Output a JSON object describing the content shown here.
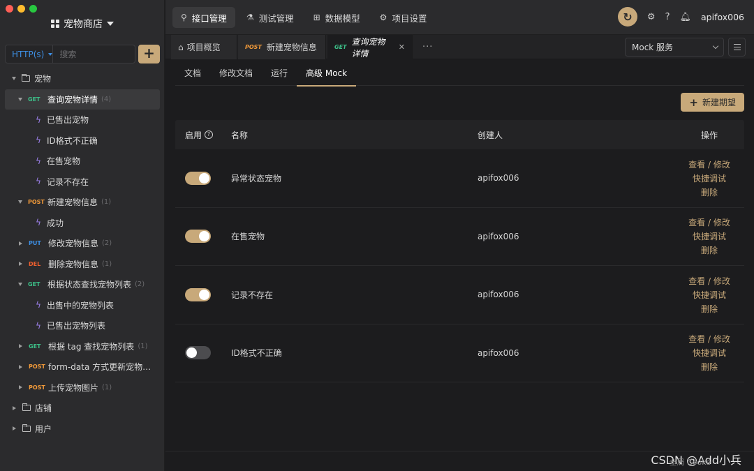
{
  "project": {
    "name": "宠物商店"
  },
  "search": {
    "method": "HTTP(s)",
    "placeholder": "搜索"
  },
  "tree": {
    "root_folder": "宠物",
    "items": [
      {
        "method": "GET",
        "label": "查询宠物详情",
        "count": "(4)"
      },
      {
        "label": "已售出宠物"
      },
      {
        "label": "ID格式不正确"
      },
      {
        "label": "在售宠物"
      },
      {
        "label": "记录不存在"
      },
      {
        "method": "POST",
        "label": "新建宠物信息",
        "count": "(1)"
      },
      {
        "label": "成功"
      },
      {
        "method": "PUT",
        "label": "修改宠物信息",
        "count": "(2)"
      },
      {
        "method": "DEL",
        "label": "删除宠物信息",
        "count": "(1)"
      },
      {
        "method": "GET",
        "label": "根据状态查找宠物列表",
        "count": "(2)"
      },
      {
        "label": "出售中的宠物列表"
      },
      {
        "label": "已售出宠物列表"
      },
      {
        "method": "GET",
        "label": "根据 tag 查找宠物列表",
        "count": "(1)"
      },
      {
        "method": "POST",
        "label": "form-data 方式更新宠物信息",
        "count": ""
      },
      {
        "method": "POST",
        "label": "上传宠物图片",
        "count": "(1)"
      }
    ],
    "other_folders": [
      "店铺",
      "用户"
    ]
  },
  "nav": {
    "items": [
      "接口管理",
      "测试管理",
      "数据模型",
      "项目设置"
    ]
  },
  "user": {
    "name": "apifox006"
  },
  "tabs": {
    "items": [
      {
        "method": "",
        "label": "项目概览"
      },
      {
        "method": "POST",
        "label": "新建宠物信息"
      },
      {
        "method": "GET",
        "label": "查询宠物详情"
      }
    ],
    "more": "···",
    "mock_service": "Mock 服务"
  },
  "subtabs": [
    "文档",
    "修改文档",
    "运行",
    "高级 Mock"
  ],
  "new_expectation": "新建期望",
  "table": {
    "headers": {
      "enable": "启用",
      "name": "名称",
      "creator": "创建人",
      "ops": "操作"
    },
    "rows": [
      {
        "enabled": true,
        "name": "异常状态宠物",
        "creator": "apifox006"
      },
      {
        "enabled": true,
        "name": "在售宠物",
        "creator": "apifox006"
      },
      {
        "enabled": true,
        "name": "记录不存在",
        "creator": "apifox006"
      },
      {
        "enabled": false,
        "name": "ID格式不正确",
        "creator": "apifox006"
      }
    ],
    "ops": {
      "view": "查看",
      "sep": "/",
      "edit": "修改",
      "debug": "快捷调试",
      "delete": "删除"
    }
  },
  "watermark": {
    "text": "CSDN @Add小兵",
    "faint": "全局 Cooke"
  },
  "colors": {
    "accent": "#c8a97a",
    "get": "#3cbf88",
    "post": "#f39b3a",
    "put": "#3d8fe4",
    "del": "#f1602f"
  }
}
